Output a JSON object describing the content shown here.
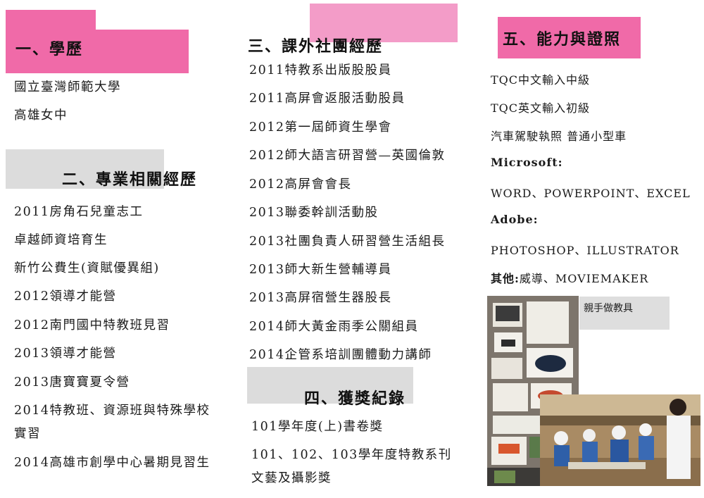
{
  "col1": {
    "edu_title": "一、學歷",
    "edu_items": [
      "國立臺灣師範大學",
      "高雄女中"
    ],
    "exp_title": "二、專業相關經歷",
    "exp_items": [
      "2011房角石兒童志工",
      "卓越師資培育生",
      "新竹公費生(資賦優異組)",
      "2012領導才能營",
      "2012南門國中特教班見習",
      "2013領導才能營",
      "2013唐寶寶夏令營",
      "2014特教班、資源班與特殊學校",
      "實習",
      "2014高雄市創學中心暑期見習生"
    ]
  },
  "col2": {
    "club_title": "三、課外社團經歷",
    "club_items": [
      "2011特教系出版股股員",
      "2011高屏會返服活動股員",
      "2012第一屆師資生學會",
      "2012師大語言研習營—英國倫敦",
      "2012高屏會會長",
      "2013聯委幹訓活動股",
      "2013社團負責人研習營生活組長",
      "2013師大新生營輔導員",
      "2013高屏宿營生器股長",
      "2014師大黃金雨季公關組員",
      "2014企管系培訓團體動力講師"
    ],
    "award_title": "四、獲獎紀錄",
    "award_items": [
      "101學年度(上)書卷獎",
      "101、102、103學年度特教系刊",
      "文藝及攝影獎"
    ]
  },
  "col3": {
    "skill_title": "五、能力與證照",
    "skill_items": [
      "TQC中文輸入中級",
      "TQC英文輸入初級",
      "汽車駕駛執照 普通小型車"
    ],
    "ms_label": "Microsoft:",
    "ms_value": "WORD、POWERPOINT、EXCEL",
    "adobe_label": "Adobe:",
    "adobe_value": "PHOTOSHOP、ILLUSTRATOR",
    "other_label": "其他:",
    "other_value": "威導、MOVIEMAKER",
    "photo_caption": "親手做教具"
  },
  "colors": {
    "pink": "#f06aa8",
    "pink_light": "#f39cc8",
    "gray": "#dcdcdc"
  }
}
